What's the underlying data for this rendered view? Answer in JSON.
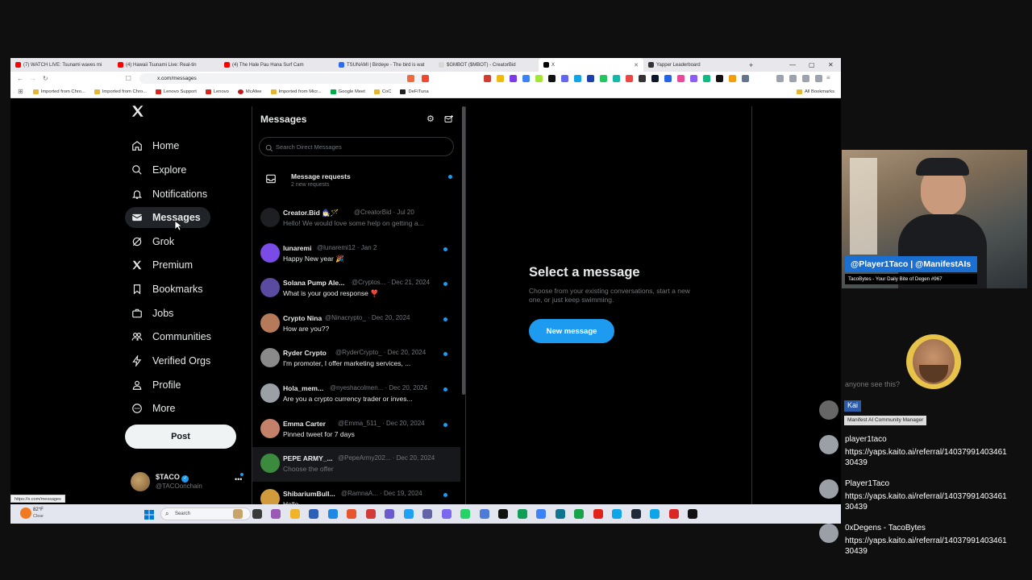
{
  "browser": {
    "tabs": [
      {
        "label": "(7) WATCH LIVE: Tsunami waves mi",
        "color": "#ff0000"
      },
      {
        "label": "(4) Hawaii Tsunami Live: Real-tin",
        "color": "#ff0000"
      },
      {
        "label": "(4) The Hale Pau Hana Surf Cam",
        "color": "#ff0000"
      },
      {
        "label": "TSUNAMI | Birdeye - The bird is wat",
        "color": "#2b6bf3"
      },
      {
        "label": "$GMBOT ($MBOT) - CreatorBid",
        "color": "#ffffff"
      },
      {
        "label": "X",
        "color": "#000000"
      },
      {
        "label": "Yapper Leaderboard",
        "color": "#333333"
      }
    ],
    "new_tab": "+",
    "url": "x.com/messages",
    "bookmarks": [
      "Imported from Chro...",
      "Imported from Chro...",
      "Lenovo Support",
      "Lenovo",
      "McAfee",
      "Imported from Micr...",
      "Google Meet",
      "CoC",
      "DeFiTuna"
    ],
    "all_bookmarks": "All Bookmarks",
    "status_url": "https://x.com/messages"
  },
  "nav": {
    "items": [
      {
        "label": "Home",
        "icon": "home-icon"
      },
      {
        "label": "Explore",
        "icon": "search-icon"
      },
      {
        "label": "Notifications",
        "icon": "bell-icon"
      },
      {
        "label": "Messages",
        "icon": "envelope-icon"
      },
      {
        "label": "Grok",
        "icon": "grok-icon"
      },
      {
        "label": "Premium",
        "icon": "x-logo-icon"
      },
      {
        "label": "Bookmarks",
        "icon": "bookmark-icon"
      },
      {
        "label": "Jobs",
        "icon": "briefcase-icon"
      },
      {
        "label": "Communities",
        "icon": "people-icon"
      },
      {
        "label": "Verified Orgs",
        "icon": "lightning-icon"
      },
      {
        "label": "Profile",
        "icon": "person-icon"
      },
      {
        "label": "More",
        "icon": "more-circle-icon"
      }
    ],
    "post": "Post",
    "profile": {
      "name": "$TACO",
      "handle": "@TACOonchain"
    }
  },
  "messages": {
    "title": "Messages",
    "search_placeholder": "Search Direct Messages",
    "requests": {
      "title": "Message requests",
      "sub": "2 new requests"
    },
    "conversations": [
      {
        "name": "Creator.Bid 🧙‍♂️🪄",
        "handle": "@CreatorBid · Jul 20",
        "preview": "Hello! We would love some help on getting a...",
        "color": "#1d1f23",
        "unread": false,
        "dim": true
      },
      {
        "name": "lunaremi",
        "handle": "@lunaremi12 · Jan 2",
        "preview": "Happy New year 🎉",
        "color": "#7b4be8",
        "unread": true,
        "dim": false
      },
      {
        "name": "Solana Pump Ale...",
        "handle": "@Cryptos... · Dec 21, 2024",
        "preview": "What is your good response ❣️",
        "color": "#5a4aa0",
        "unread": true,
        "dim": false
      },
      {
        "name": "Crypto Nina",
        "handle": "@Ninacrypto_ · Dec 20, 2024",
        "preview": "How are you??",
        "color": "#b47a5a",
        "unread": true,
        "dim": false
      },
      {
        "name": "Ryder Crypto",
        "handle": "@RyderCrypto_ · Dec 20, 2024",
        "preview": "I'm promoter, I offer marketing services, ...",
        "color": "#8a8a8a",
        "unread": true,
        "dim": false
      },
      {
        "name": "Hola_mem...",
        "handle": "@nyeshacolmen... · Dec 20, 2024",
        "preview": "Are you a crypto currency trader or inves...",
        "color": "#9aa0a6",
        "unread": true,
        "dim": false
      },
      {
        "name": "Emma Carter",
        "handle": "@Emma_511_ · Dec 20, 2024",
        "preview": "Pinned tweet for 7 days",
        "color": "#c4816a",
        "unread": true,
        "dim": false
      },
      {
        "name": "PEPE ARMY_...",
        "handle": "@PepeArmy202... · Dec 20, 2024",
        "preview": "Choose the offer",
        "color": "#3b8a3e",
        "unread": false,
        "dim": true
      },
      {
        "name": "ShibariumBull...",
        "handle": "@RamnaA... · Dec 19, 2024",
        "preview": "Hello",
        "color": "#d19a3a",
        "unread": true,
        "dim": false
      }
    ]
  },
  "detail": {
    "title": "Select a message",
    "subtitle": "Choose from your existing conversations, start a new one, or just keep swimming.",
    "button": "New message"
  },
  "taskbar": {
    "weather": "82°F",
    "weather_sub": "Clear",
    "search": "Search"
  },
  "stream": {
    "caption": "@Player1Taco | @ManifestAIs",
    "subcaption": "TacoBytes - Your Daily Bite of Degen #967",
    "chat": [
      {
        "name": "",
        "msg": "anyone see this?"
      },
      {
        "name": "Kai",
        "msg": "Manifest AI Community Manager"
      },
      {
        "name": "player1taco",
        "msg": "https://yaps.kaito.ai/referral/1403799140346130439"
      },
      {
        "name": "Player1Taco",
        "msg": "https://yaps.kaito.ai/referral/1403799140346130439"
      },
      {
        "name": "0xDegens - TacoBytes",
        "msg": "https://yaps.kaito.ai/referral/1403799140346130439"
      }
    ]
  }
}
